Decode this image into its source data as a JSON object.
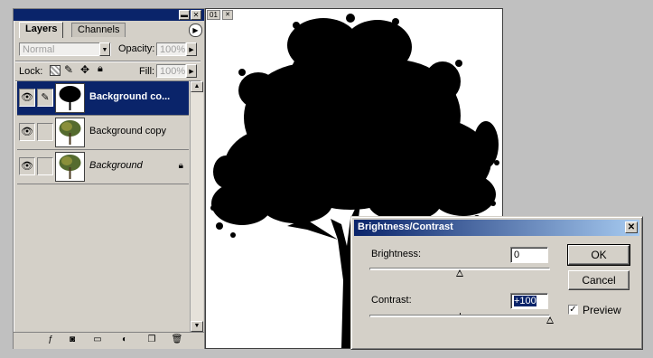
{
  "layers_panel": {
    "tabs": [
      {
        "label": "Layers"
      },
      {
        "label": "Channels"
      }
    ],
    "blend_mode": "Normal",
    "opacity_label": "Opacity:",
    "opacity_value": "100%",
    "lock_label": "Lock:",
    "fill_label": "Fill:",
    "fill_value": "100%",
    "layers": [
      {
        "name": "Background co...",
        "selected": true,
        "visible": true,
        "thumbnail": "black-tree-silhouette",
        "linked_icon": "brush-icon"
      },
      {
        "name": "Background copy",
        "selected": false,
        "visible": true,
        "thumbnail": "color-tree"
      },
      {
        "name": "Background",
        "selected": false,
        "visible": true,
        "thumbnail": "color-tree",
        "locked": true
      }
    ],
    "bottom_icons": [
      "layer-style-icon",
      "mask-icon",
      "new-set-icon",
      "adjustment-layer-icon",
      "new-layer-icon",
      "trash-icon"
    ]
  },
  "document": {
    "tag": "01",
    "content": "black tree silhouette on white background"
  },
  "dialog": {
    "title": "Brightness/Contrast",
    "brightness_label": "Brightness:",
    "brightness_value": "0",
    "brightness_level": 0,
    "contrast_label": "Contrast:",
    "contrast_value": "+100",
    "contrast_level": 100,
    "ok_label": "OK",
    "cancel_label": "Cancel",
    "preview_label": "Preview",
    "preview_checked": true
  },
  "colors": {
    "titlebar": "#0a246a",
    "selection": "#0a246a",
    "chrome": "#d4d0c8",
    "desktop": "#c0c0c0"
  }
}
